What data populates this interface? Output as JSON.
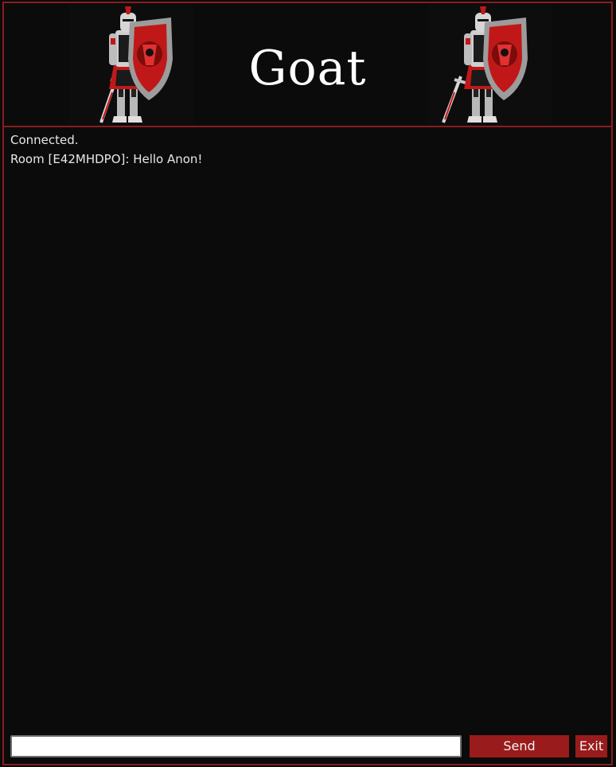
{
  "header": {
    "title": "Goat",
    "knight_icon": "knight-with-shield-icon"
  },
  "chat": {
    "messages": [
      "Connected.",
      "Room [E42MHDPO]: Hello Anon!"
    ]
  },
  "composer": {
    "input_value": "",
    "input_placeholder": "",
    "send_label": "Send",
    "exit_label": "Exit"
  },
  "colors": {
    "background": "#0b0b0b",
    "border": "#8a1c1c",
    "accent": "#9a1b1b",
    "text": "#e8e8e8"
  }
}
